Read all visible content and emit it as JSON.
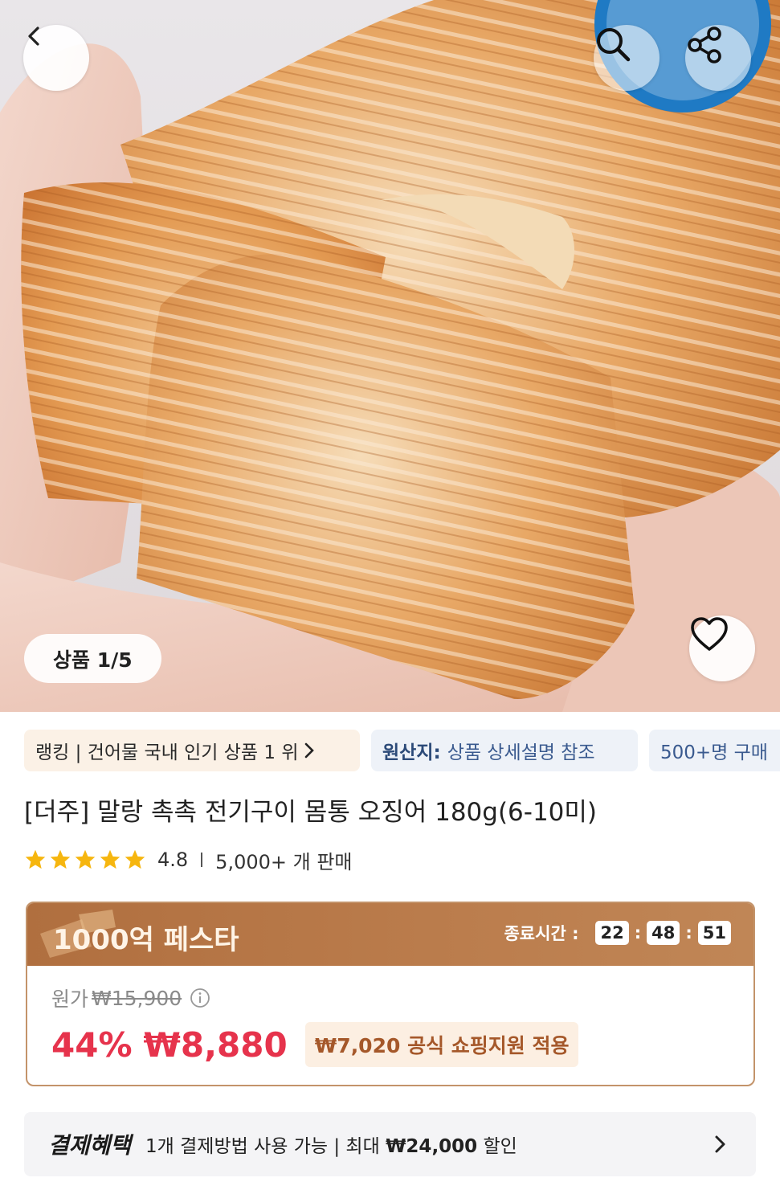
{
  "hero": {
    "image_counter": "상품 1/5",
    "icons": [
      "back-arrow-icon",
      "search-icon",
      "share-icon",
      "heart-icon"
    ]
  },
  "chips": {
    "ranking": "랭킹 | 건어물 국내 인기 상품 1 위",
    "origin_label": "원산지:",
    "origin_value": "상품 상세설명 참조",
    "buyers": "500+명 구매"
  },
  "product": {
    "title": "[더주] 말랑 촉촉 전기구이 몸통 오징어 180g(6-10미)",
    "rating": "4.8",
    "stars": 5,
    "sold": "5,000+ 개 판매"
  },
  "promo": {
    "title": "1000억 페스타",
    "end_label": "종료시간 :",
    "timer": [
      "22",
      "48",
      "51"
    ],
    "original_label": "원가",
    "original_price": "₩15,900",
    "discount": "44%",
    "sale_price": "₩8,880",
    "support_badge": "₩7,020 공식 쇼핑지원 적용"
  },
  "payment": {
    "title": "결제혜택",
    "desc_prefix": "1개 결제방법 사용 가능 | 최대 ",
    "max_amount": "₩24,000",
    "desc_suffix": " 할인"
  },
  "colors": {
    "price_red": "#e6334c",
    "promo_brown": "#b06f3f",
    "star_yellow": "#f6b60f",
    "origin_blue": "#3a5a8f"
  }
}
